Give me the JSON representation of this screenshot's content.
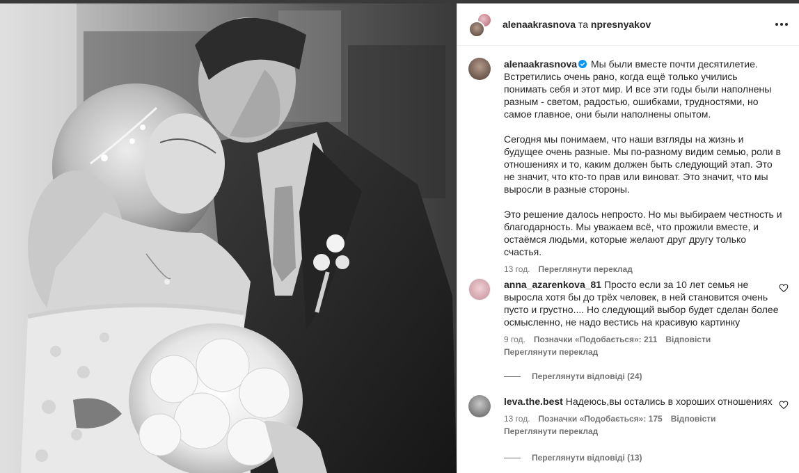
{
  "header": {
    "user_primary": "alenaakrasnova",
    "separator": "та",
    "user_secondary": "npresnyakov"
  },
  "caption": {
    "username": "alenaakrasnova",
    "paragraphs": [
      "Мы были вместе почти десятилетие. Встретились очень рано, когда ещё только учились понимать себя и этот мир. И все эти годы были наполнены разным - светом, радостью, ошибками, трудностями, но самое главное, они были наполнены опытом.",
      "Сегодня мы понимаем, что наши взгляды на жизнь и будущее очень разные. Мы по-разному видим семью, роли в отношениях и то, каким должен быть следующий этап. Это не значит, что кто-то прав или виноват. Это значит, что мы выросли в разные стороны.",
      "Это решение далось непросто. Но мы выбираем честность и благодарность. Мы уважаем всё, что прожили вместе, и остаёмся людьми, которые желают друг другу только счастья."
    ],
    "time": "13 год.",
    "translate": "Переглянути переклад"
  },
  "comments": [
    {
      "username": "anna_azarenkova_81",
      "text": "Просто если за 10 лет семья не выросла хотя бы до трёх человек, в ней становится очень пусто и грустно.... Но следующий выбор будет сделан более осмысленно, не надо вестись на красивую картинку",
      "time": "9 год.",
      "likes": "Позначки «Подобається»: 211",
      "reply": "Відповісти",
      "translate": "Переглянути переклад",
      "view_replies": "Переглянути відповіді (24)"
    },
    {
      "username": "leva.the.best",
      "text": "Надеюсь,вы остались в хороших отношениях",
      "time": "13 год.",
      "likes": "Позначки «Подобається»: 175",
      "reply": "Відповісти",
      "translate": "Переглянути переклад",
      "view_replies": "Переглянути відповіді (13)"
    }
  ],
  "icons": {
    "more": "more-horizontal-icon",
    "verified": "verified-badge-icon",
    "like": "heart-outline-icon"
  },
  "colors": {
    "verified": "#0095f6",
    "secondary_text": "#737373",
    "primary_text": "#262626"
  }
}
